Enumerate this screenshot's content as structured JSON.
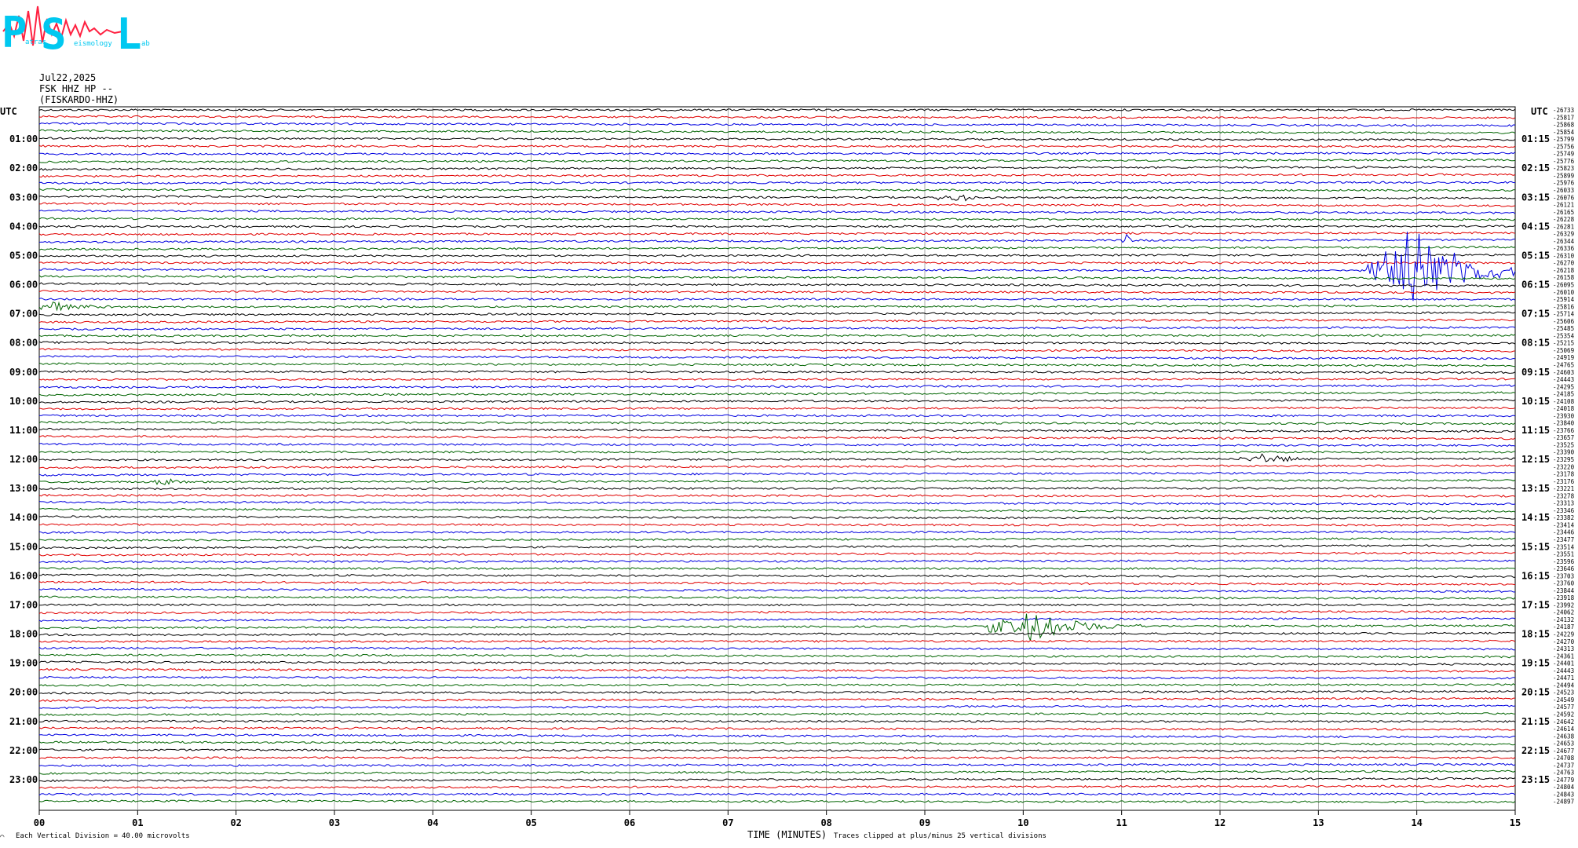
{
  "header": {
    "date": "Jul22,2025",
    "station": "FSK HHZ HP --",
    "station_name": "(FISKARDO-HHZ)",
    "logo_letters": [
      "P",
      "S",
      "L"
    ],
    "logo_words": [
      "atras",
      "eismology",
      "ab"
    ]
  },
  "utc_label": "UTC",
  "chart_data": {
    "type": "line",
    "xlabel": "TIME (MINUTES)",
    "x_ticks": [
      "00",
      "01",
      "02",
      "03",
      "04",
      "05",
      "06",
      "07",
      "08",
      "09",
      "10",
      "11",
      "12",
      "13",
      "14",
      "15"
    ],
    "xlim": [
      0,
      15
    ],
    "left_hour_labels": [
      "01:00",
      "02:00",
      "03:00",
      "04:00",
      "05:00",
      "06:00",
      "07:00",
      "08:00",
      "09:00",
      "10:00",
      "11:00",
      "12:00",
      "13:00",
      "14:00",
      "15:00",
      "16:00",
      "17:00",
      "18:00",
      "19:00",
      "20:00",
      "21:00",
      "22:00",
      "23:00"
    ],
    "right_hour_labels": [
      "01:15",
      "02:15",
      "03:15",
      "04:15",
      "05:15",
      "06:15",
      "07:15",
      "08:15",
      "09:15",
      "10:15",
      "11:15",
      "12:15",
      "13:15",
      "14:15",
      "15:15",
      "16:15",
      "17:15",
      "18:15",
      "19:15",
      "20:15",
      "21:15",
      "22:15",
      "23:15"
    ],
    "trace_colors": [
      "#000000",
      "#e00000",
      "#0000e0",
      "#006400"
    ],
    "trace_count": 96,
    "trace_offsets": [
      -26733,
      -25817,
      -25868,
      -25854,
      -25799,
      -25756,
      -25749,
      -25776,
      -25823,
      -25899,
      -25976,
      -26033,
      -26076,
      -26121,
      -26165,
      -26228,
      -26281,
      -26329,
      -26344,
      -26336,
      -26310,
      -26270,
      -26218,
      -26158,
      -26095,
      -26010,
      -25914,
      -25816,
      -25714,
      -25606,
      -25485,
      -25354,
      -25215,
      -25069,
      -24919,
      -24765,
      -24603,
      -24443,
      -24295,
      -24185,
      -24108,
      -24018,
      -23930,
      -23840,
      -23766,
      -23657,
      -23525,
      -23390,
      -23295,
      -23220,
      -23178,
      -23176,
      -23221,
      -23278,
      -23313,
      -23346,
      -23382,
      -23414,
      -23446,
      -23477,
      -23514,
      -23551,
      -23596,
      -23646,
      -23703,
      -23760,
      -23844,
      -23918,
      -23992,
      -24062,
      -24132,
      -24187,
      -24229,
      -24270,
      -24313,
      -24361,
      -24401,
      -24443,
      -24471,
      -24494,
      -24523,
      -24549,
      -24577,
      -24592,
      -24642,
      -24614,
      -24638,
      -24653,
      -24677,
      -24708,
      -24737,
      -24763,
      -24779,
      -24804,
      -24843,
      -24897
    ],
    "events": [
      {
        "trace": 22,
        "minute_start": 13.5,
        "minute_end": 15,
        "peak_minute": 13.9,
        "color": "#0000e0"
      },
      {
        "trace": 71,
        "minute_start": 9.65,
        "minute_end": 11.2,
        "peak_minute": 10.0,
        "color": "#006400"
      },
      {
        "trace": 18,
        "minute_start": 11.0,
        "minute_end": 11.15,
        "peak_minute": 11.05,
        "color": "#000000"
      },
      {
        "trace": 48,
        "minute_start": 12.2,
        "minute_end": 13.0,
        "peak_minute": 12.4,
        "color": "#006400"
      },
      {
        "trace": 12,
        "minute_start": 9.1,
        "minute_end": 9.6,
        "peak_minute": 9.4,
        "color": "#006400"
      },
      {
        "trace": 51,
        "minute_start": 1.1,
        "minute_end": 1.5,
        "peak_minute": 1.3,
        "color": "#e00000"
      },
      {
        "trace": 27,
        "minute_start": 0.0,
        "minute_end": 0.9,
        "peak_minute": 0.1,
        "color": "#006400"
      }
    ]
  },
  "footer": {
    "left_mark": "⌒",
    "vertical_division": "Each Vertical Division =",
    "vertical_value": "40.00 microvolts",
    "clip_note": "Traces clipped at plus/minus 25 vertical divisions"
  }
}
